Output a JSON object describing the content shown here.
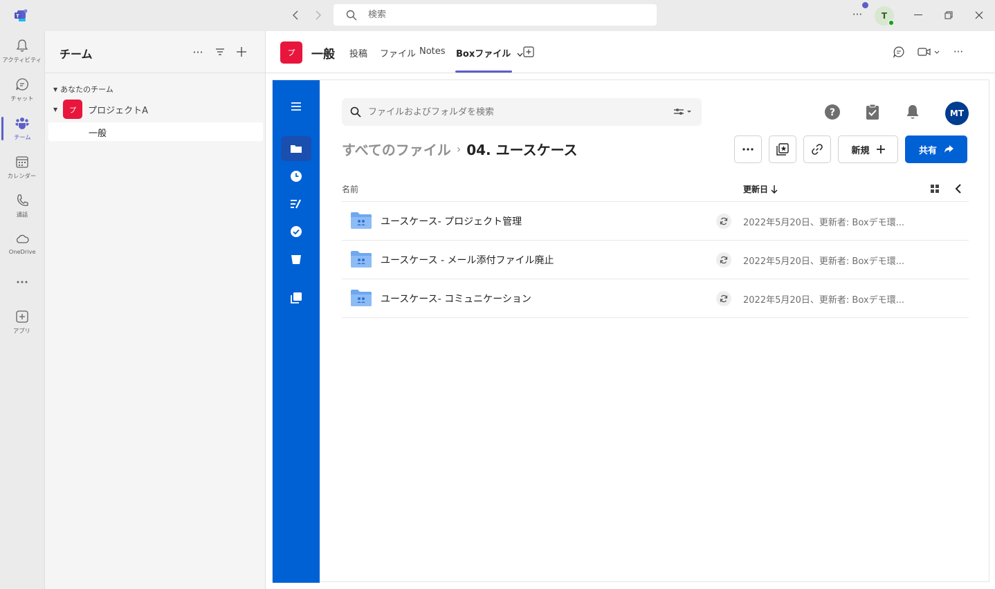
{
  "titlebar": {
    "search_placeholder": "検索",
    "profile_initial": "T"
  },
  "rail": [
    {
      "label": "アクティビティ",
      "icon": "bell-icon"
    },
    {
      "label": "チャット",
      "icon": "chat-icon"
    },
    {
      "label": "チーム",
      "icon": "teams-icon"
    },
    {
      "label": "カレンダー",
      "icon": "calendar-icon"
    },
    {
      "label": "通話",
      "icon": "phone-icon"
    },
    {
      "label": "OneDrive",
      "icon": "cloud-icon"
    },
    {
      "label": "アプリ",
      "icon": "apps-icon"
    }
  ],
  "teams_panel": {
    "title": "チーム",
    "section_label": "あなたのチーム",
    "team_name": "プロジェクトA",
    "team_avatar": "プ",
    "channel_name": "一般"
  },
  "channel": {
    "avatar": "プ",
    "name": "一般",
    "tabs": [
      "投稿",
      "ファイル",
      "Notes",
      "Boxファイル"
    ],
    "active_tab": "Boxファイル"
  },
  "box": {
    "search_placeholder": "ファイルおよびフォルダを検索",
    "avatar": "MT",
    "breadcrumb_root": "すべてのファイル",
    "breadcrumb_sep": "›",
    "breadcrumb_current": "04. ユースケース",
    "new_label": "新規",
    "share_label": "共有",
    "column_name": "名前",
    "column_updated": "更新日",
    "brand_color": "#0061d5",
    "files": [
      {
        "name": "ユースケース- プロジェクト管理",
        "updated": "2022年5月20日、更新者: Boxデモ環..."
      },
      {
        "name": "ユースケース - メール添付ファイル廃止",
        "updated": "2022年5月20日、更新者: Boxデモ環..."
      },
      {
        "name": "ユースケース- コミュニケーション",
        "updated": "2022年5月20日、更新者: Boxデモ環..."
      }
    ]
  }
}
